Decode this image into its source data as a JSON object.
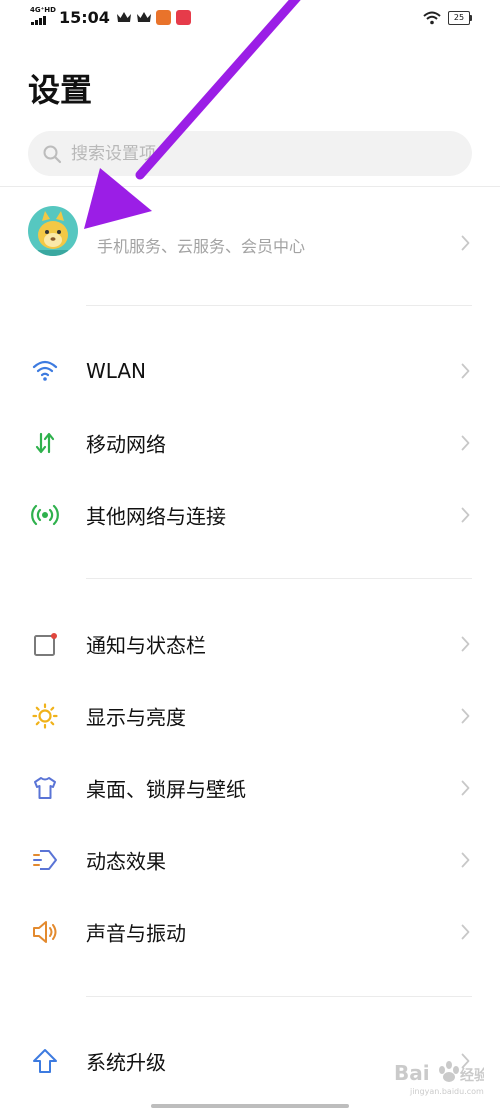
{
  "status_bar": {
    "network_type": "4G⁺HD",
    "time": "15:04",
    "battery_level": "25",
    "colors": {
      "app1": "#e9732b",
      "app2": "#e63b4a"
    }
  },
  "header": {
    "title": "设置"
  },
  "search": {
    "placeholder": "搜索设置项",
    "value": ""
  },
  "account": {
    "subtitle": "手机服务、云服务、会员中心"
  },
  "sections": [
    {
      "items": [
        {
          "label": "WLAN",
          "icon": "wifi-icon",
          "color": "#3d7be0"
        },
        {
          "label": "移动网络",
          "icon": "mobile-data-icon",
          "color": "#2fb14d"
        },
        {
          "label": "其他网络与连接",
          "icon": "connection-icon",
          "color": "#2fb14d"
        }
      ]
    },
    {
      "items": [
        {
          "label": "通知与状态栏",
          "icon": "notification-icon",
          "color": "#7a7a7a"
        },
        {
          "label": "显示与亮度",
          "icon": "brightness-icon",
          "color": "#f0b21a"
        },
        {
          "label": "桌面、锁屏与壁纸",
          "icon": "wallpaper-icon",
          "color": "#5a74d6"
        },
        {
          "label": "动态效果",
          "icon": "motion-effects-icon",
          "color": "#5a74d6"
        },
        {
          "label": "声音与振动",
          "icon": "sound-icon",
          "color": "#e38a2e"
        }
      ]
    },
    {
      "items": [
        {
          "label": "系统升级",
          "icon": "system-update-icon",
          "color": "#3d7be0"
        }
      ]
    }
  ],
  "overlay": {
    "annotation_arrow_color": "#9b1ee6",
    "watermark": "Bai 经验 jingyan.baidu.com"
  }
}
